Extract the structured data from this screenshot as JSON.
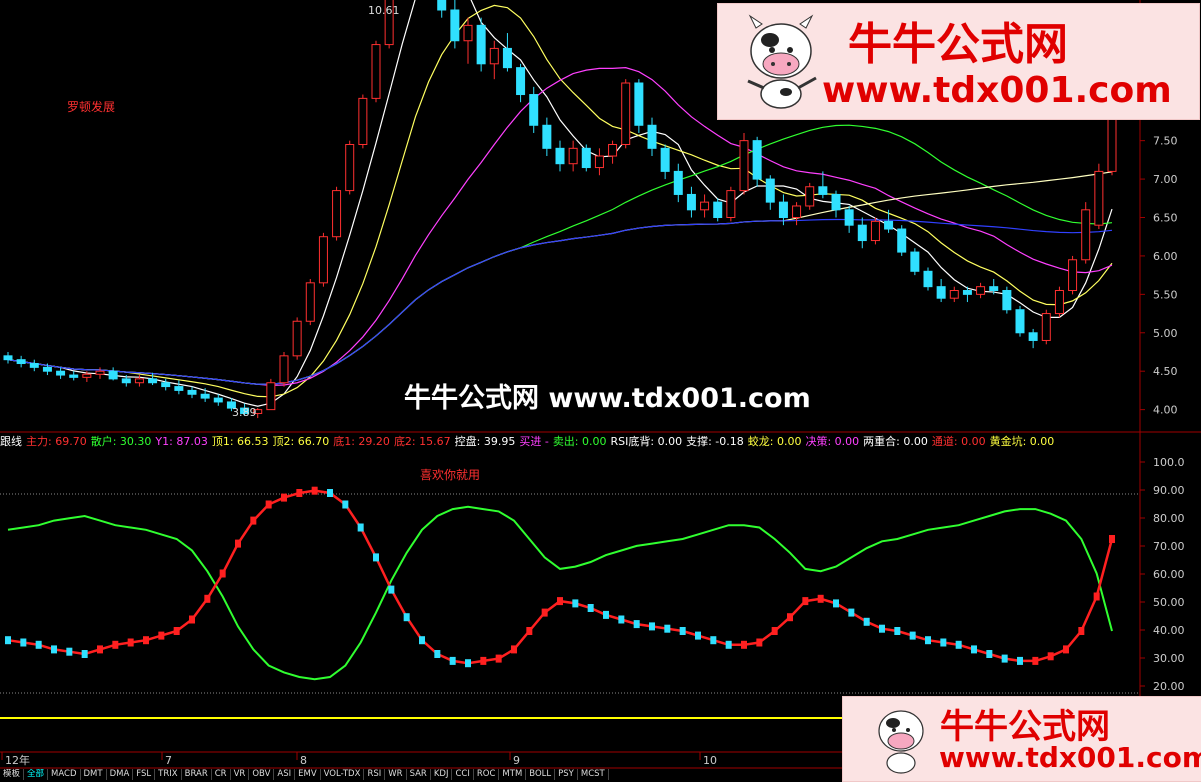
{
  "top_panel": {
    "label_left": "罗顿发展",
    "high_label": "10.61",
    "low_label": "3.89",
    "price_ticks": [
      "8.50",
      "8.00",
      "7.50",
      "7.00",
      "6.50",
      "6.00",
      "5.50",
      "5.00",
      "4.50",
      "4.00"
    ]
  },
  "watermark_top": {
    "title": "牛牛公式网",
    "url": "www.tdx001.com"
  },
  "watermark_mid": {
    "text": "牛牛公式网 www.tdx001.com"
  },
  "watermark_bottom": {
    "title": "牛牛公式网",
    "url": "www.tdx001.com"
  },
  "indicator_bar": [
    {
      "label": "跟线",
      "color": "#ffffff"
    },
    {
      "label": "主力: 69.70",
      "color": "#ff3030"
    },
    {
      "label": "散户: 30.30",
      "color": "#30ff30"
    },
    {
      "label": "Y1: 87.03",
      "color": "#ff40ff"
    },
    {
      "label": "顶1: 66.53",
      "color": "#ffff40"
    },
    {
      "label": "顶2: 66.70",
      "color": "#ffff40"
    },
    {
      "label": "底1: 29.20",
      "color": "#ff3030"
    },
    {
      "label": "底2: 15.67",
      "color": "#ff3030"
    },
    {
      "label": "控盘: 39.95",
      "color": "#ffffff"
    },
    {
      "label": "买进 -",
      "color": "#ff40ff"
    },
    {
      "label": "卖出: 0.00",
      "color": "#30ff30"
    },
    {
      "label": "RSI底背: 0.00",
      "color": "#ffffff"
    },
    {
      "label": "支撑: -0.18",
      "color": "#ffffff"
    },
    {
      "label": "蛟龙: 0.00",
      "color": "#ffff40"
    },
    {
      "label": "决策: 0.00",
      "color": "#ff40ff"
    },
    {
      "label": "两重合: 0.00",
      "color": "#ffffff"
    },
    {
      "label": "通道: 0.00",
      "color": "#ff3030"
    },
    {
      "label": "黄金坑: 0.00",
      "color": "#ffff40"
    }
  ],
  "lower_panel": {
    "annotation": "喜欢你就用",
    "ticks": [
      "100.0",
      "90.00",
      "80.00",
      "70.00",
      "60.00",
      "50.00",
      "40.00",
      "30.00",
      "20.00"
    ]
  },
  "date_axis": [
    "12年",
    "7",
    "8",
    "9",
    "10"
  ],
  "tabs": [
    "模板",
    "全部",
    "MACD",
    "DMT",
    "DMA",
    "FSL",
    "TRIX",
    "BRAR",
    "CR",
    "VR",
    "OBV",
    "ASI",
    "EMV",
    "VOL-TDX",
    "RSI",
    "WR",
    "SAR",
    "KDJ",
    "CCI",
    "ROC",
    "MTM",
    "BOLL",
    "PSY",
    "MCST"
  ],
  "active_tab": "全部",
  "chart_data": {
    "type": "candlestick",
    "price_high": 10.61,
    "price_low": 3.89,
    "y_range": [
      3.8,
      9.2
    ],
    "candles": [
      [
        4.7,
        4.75,
        4.6,
        4.65
      ],
      [
        4.65,
        4.7,
        4.55,
        4.6
      ],
      [
        4.6,
        4.65,
        4.5,
        4.55
      ],
      [
        4.55,
        4.6,
        4.45,
        4.5
      ],
      [
        4.5,
        4.55,
        4.4,
        4.45
      ],
      [
        4.45,
        4.5,
        4.38,
        4.42
      ],
      [
        4.42,
        4.5,
        4.36,
        4.46
      ],
      [
        4.46,
        4.55,
        4.4,
        4.5
      ],
      [
        4.5,
        4.55,
        4.38,
        4.4
      ],
      [
        4.4,
        4.45,
        4.3,
        4.35
      ],
      [
        4.35,
        4.45,
        4.3,
        4.4
      ],
      [
        4.4,
        4.48,
        4.32,
        4.35
      ],
      [
        4.35,
        4.4,
        4.25,
        4.3
      ],
      [
        4.3,
        4.38,
        4.2,
        4.25
      ],
      [
        4.25,
        4.3,
        4.15,
        4.2
      ],
      [
        4.2,
        4.28,
        4.1,
        4.15
      ],
      [
        4.15,
        4.2,
        4.05,
        4.1
      ],
      [
        4.1,
        4.15,
        3.98,
        4.02
      ],
      [
        4.02,
        4.08,
        3.92,
        3.95
      ],
      [
        3.95,
        4.02,
        3.89,
        4.0
      ],
      [
        4.0,
        4.4,
        4.0,
        4.35
      ],
      [
        4.35,
        4.75,
        4.3,
        4.7
      ],
      [
        4.7,
        5.2,
        4.65,
        5.15
      ],
      [
        5.15,
        5.7,
        5.1,
        5.65
      ],
      [
        5.65,
        6.3,
        5.6,
        6.25
      ],
      [
        6.25,
        6.9,
        6.2,
        6.85
      ],
      [
        6.85,
        7.5,
        6.8,
        7.45
      ],
      [
        7.45,
        8.1,
        7.4,
        8.05
      ],
      [
        8.05,
        8.8,
        8.0,
        8.75
      ],
      [
        8.75,
        9.5,
        8.7,
        9.45
      ],
      [
        9.45,
        10.2,
        9.4,
        10.1
      ],
      [
        10.1,
        10.61,
        9.9,
        10.4
      ],
      [
        10.4,
        10.5,
        9.6,
        9.7
      ],
      [
        9.7,
        9.9,
        9.1,
        9.2
      ],
      [
        9.2,
        9.4,
        8.7,
        8.8
      ],
      [
        8.8,
        9.1,
        8.5,
        9.0
      ],
      [
        9.0,
        9.1,
        8.4,
        8.5
      ],
      [
        8.5,
        8.8,
        8.3,
        8.7
      ],
      [
        8.7,
        8.9,
        8.4,
        8.45
      ],
      [
        8.45,
        8.5,
        8.0,
        8.1
      ],
      [
        8.1,
        8.2,
        7.6,
        7.7
      ],
      [
        7.7,
        7.8,
        7.3,
        7.4
      ],
      [
        7.4,
        7.5,
        7.1,
        7.2
      ],
      [
        7.2,
        7.5,
        7.1,
        7.4
      ],
      [
        7.4,
        7.45,
        7.1,
        7.15
      ],
      [
        7.15,
        7.4,
        7.05,
        7.3
      ],
      [
        7.3,
        7.5,
        7.2,
        7.45
      ],
      [
        7.45,
        8.3,
        7.4,
        8.25
      ],
      [
        8.25,
        8.3,
        7.6,
        7.7
      ],
      [
        7.7,
        7.8,
        7.3,
        7.4
      ],
      [
        7.4,
        7.45,
        7.0,
        7.1
      ],
      [
        7.1,
        7.2,
        6.7,
        6.8
      ],
      [
        6.8,
        6.9,
        6.5,
        6.6
      ],
      [
        6.6,
        6.8,
        6.5,
        6.7
      ],
      [
        6.7,
        6.75,
        6.45,
        6.5
      ],
      [
        6.5,
        6.9,
        6.45,
        6.85
      ],
      [
        6.85,
        7.6,
        6.8,
        7.5
      ],
      [
        7.5,
        7.55,
        6.9,
        7.0
      ],
      [
        7.0,
        7.05,
        6.6,
        6.7
      ],
      [
        6.7,
        6.8,
        6.4,
        6.5
      ],
      [
        6.5,
        6.7,
        6.4,
        6.65
      ],
      [
        6.65,
        6.95,
        6.6,
        6.9
      ],
      [
        6.9,
        7.1,
        6.75,
        6.8
      ],
      [
        6.8,
        6.85,
        6.5,
        6.6
      ],
      [
        6.6,
        6.65,
        6.3,
        6.4
      ],
      [
        6.4,
        6.5,
        6.1,
        6.2
      ],
      [
        6.2,
        6.5,
        6.15,
        6.45
      ],
      [
        6.45,
        6.6,
        6.3,
        6.35
      ],
      [
        6.35,
        6.4,
        6.0,
        6.05
      ],
      [
        6.05,
        6.1,
        5.75,
        5.8
      ],
      [
        5.8,
        5.85,
        5.55,
        5.6
      ],
      [
        5.6,
        5.7,
        5.4,
        5.45
      ],
      [
        5.45,
        5.6,
        5.4,
        5.55
      ],
      [
        5.55,
        5.6,
        5.4,
        5.5
      ],
      [
        5.5,
        5.65,
        5.45,
        5.6
      ],
      [
        5.6,
        5.7,
        5.5,
        5.55
      ],
      [
        5.55,
        5.6,
        5.25,
        5.3
      ],
      [
        5.3,
        5.35,
        4.95,
        5.0
      ],
      [
        5.0,
        5.05,
        4.8,
        4.9
      ],
      [
        4.9,
        5.3,
        4.85,
        5.25
      ],
      [
        5.25,
        5.6,
        5.2,
        5.55
      ],
      [
        5.55,
        6.0,
        5.5,
        5.95
      ],
      [
        5.95,
        6.7,
        5.9,
        6.6
      ],
      [
        6.4,
        7.2,
        6.35,
        7.1
      ],
      [
        7.1,
        7.9,
        7.05,
        7.85
      ]
    ],
    "lower_series": {
      "main_force_red": [
        26,
        25,
        24,
        22,
        21,
        20,
        22,
        24,
        25,
        26,
        28,
        30,
        35,
        44,
        55,
        68,
        78,
        85,
        88,
        90,
        91,
        90,
        85,
        75,
        62,
        48,
        36,
        26,
        20,
        17,
        16,
        17,
        18,
        22,
        30,
        38,
        43,
        42,
        40,
        37,
        35,
        33,
        32,
        31,
        30,
        28,
        26,
        24,
        24,
        25,
        30,
        36,
        43,
        44,
        42,
        38,
        34,
        31,
        30,
        28,
        26,
        25,
        24,
        22,
        20,
        18,
        17,
        17,
        19,
        22,
        30,
        45,
        70
      ],
      "retail_green": [
        74,
        75,
        76,
        78,
        79,
        80,
        78,
        76,
        75,
        74,
        72,
        70,
        65,
        56,
        45,
        32,
        22,
        15,
        12,
        10,
        9,
        10,
        15,
        25,
        38,
        52,
        64,
        74,
        80,
        83,
        84,
        83,
        82,
        78,
        70,
        62,
        57,
        58,
        60,
        63,
        65,
        67,
        68,
        69,
        70,
        72,
        74,
        76,
        76,
        75,
        70,
        64,
        57,
        56,
        58,
        62,
        66,
        69,
        70,
        72,
        74,
        75,
        76,
        78,
        80,
        82,
        83,
        83,
        81,
        78,
        70,
        55,
        30
      ]
    }
  }
}
